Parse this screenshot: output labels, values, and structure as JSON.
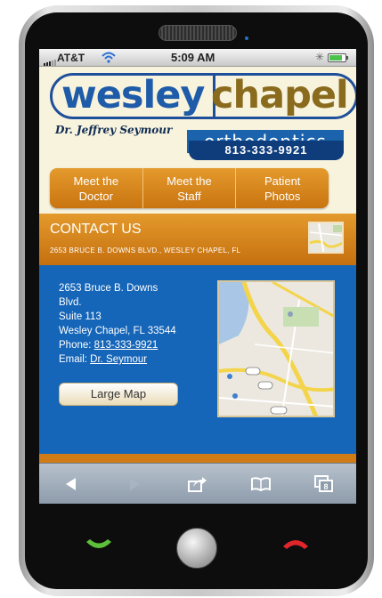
{
  "status_bar": {
    "carrier": "AT&T",
    "time": "5:09 AM",
    "battery_level": 0.85,
    "icons": [
      "signal-icon",
      "wifi-icon",
      "bluetooth-icon",
      "battery-icon"
    ]
  },
  "header": {
    "logo_word1": "wesley",
    "logo_word2": "chapel",
    "logo_word3": "orthodontics",
    "doctor": "Dr. Jeffrey Seymour",
    "phone": "813-333-9921"
  },
  "nav": {
    "items": [
      {
        "label": "Meet the\nDoctor"
      },
      {
        "label": "Meet the\nStaff"
      },
      {
        "label": "Patient\nPhotos"
      }
    ]
  },
  "contact": {
    "title": "CONTACT US",
    "address_caps": "2653 BRUCE B. DOWNS BLVD., WESLEY CHAPEL, FL",
    "lines": [
      "2653 Bruce B. Downs",
      "Blvd.",
      "Suite 113",
      "Wesley Chapel, FL 33544"
    ],
    "phone_label": "Phone:",
    "phone": "813-333-9921",
    "email_label": "Email:",
    "email": "Dr. Seymour",
    "large_map_label": "Large Map"
  },
  "toolbar": {
    "icons": [
      "back-icon",
      "forward-icon",
      "share-icon",
      "bookmarks-icon",
      "tabs-icon"
    ],
    "tab_count": "8"
  },
  "colors": {
    "brand_blue": "#1565b8",
    "brand_orange": "#d07b16",
    "logo_gold": "#8a6b1e",
    "call_green": "#5cc03a",
    "call_red": "#e0262b"
  }
}
